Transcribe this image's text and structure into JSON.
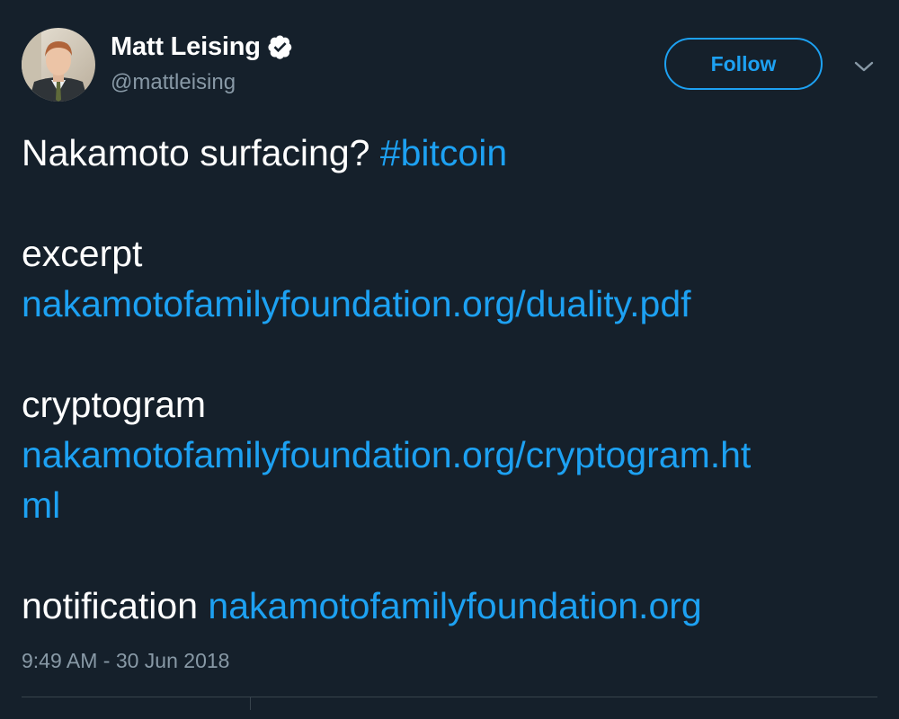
{
  "author": {
    "display_name": "Matt Leising",
    "handle": "@mattleising",
    "verified": true
  },
  "actions": {
    "follow_label": "Follow"
  },
  "tweet": {
    "intro_text": "Nakamoto surfacing?",
    "hashtag": "#bitcoin",
    "excerpt_label": "excerpt",
    "excerpt_link": "nakamotofamilyfoundation.org/duality.pdf",
    "cryptogram_label": "cryptogram",
    "cryptogram_link_line1": "nakamotofamilyfoundation.org/cryptogram.ht",
    "cryptogram_link_line2": "ml",
    "notification_label": "notification",
    "notification_link": "nakamotofamilyfoundation.org"
  },
  "timestamp": "9:49 AM - 30 Jun 2018",
  "icons": {
    "verified": "verified-badge-icon",
    "more": "chevron-down-icon"
  },
  "colors": {
    "background": "#15202b",
    "link": "#1da1f2",
    "secondary_text": "#8899a6",
    "primary_text": "#ffffff",
    "divider": "#38444d"
  }
}
